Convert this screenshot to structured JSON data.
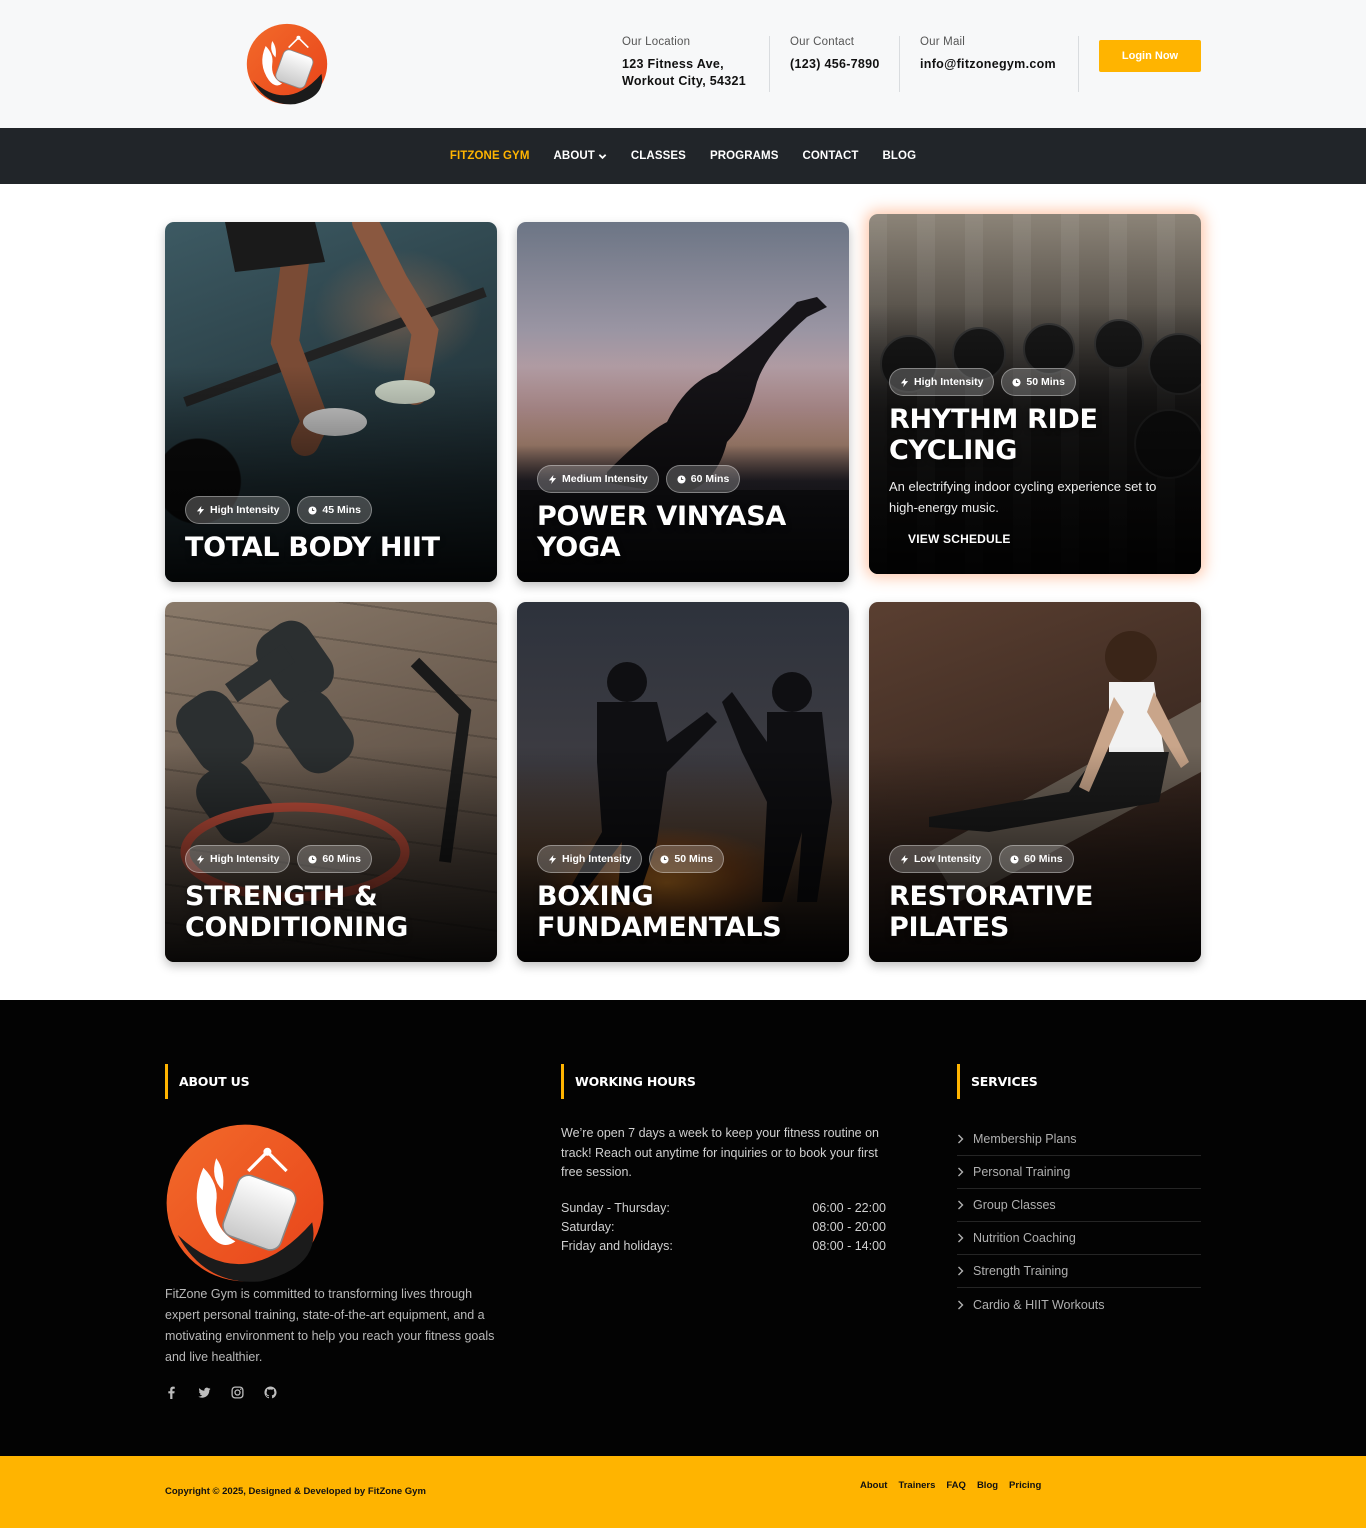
{
  "header": {
    "location_label": "Our Location",
    "location_line1": "123 Fitness Ave,",
    "location_line2": "Workout City, 54321",
    "contact_label": "Our Contact",
    "contact_value": "(123) 456-7890",
    "mail_label": "Our Mail",
    "mail_value": "info@fitzonegym.com",
    "login_label": "Login Now"
  },
  "nav": {
    "items": [
      "FITZONE GYM",
      "ABOUT",
      "CLASSES",
      "PROGRAMS",
      "CONTACT",
      "BLOG"
    ],
    "active_index": 0
  },
  "cards": [
    {
      "title": "TOTAL BODY HIIT",
      "intensity": "High Intensity",
      "duration": "45 Mins"
    },
    {
      "title": "POWER VINYASA YOGA",
      "intensity": "Medium Intensity",
      "duration": "60 Mins"
    },
    {
      "title": "RHYTHM RIDE CYCLING",
      "intensity": "High Intensity",
      "duration": "50 Mins",
      "description": "An electrifying indoor cycling experience set to high-energy music.",
      "link": "VIEW SCHEDULE"
    },
    {
      "title": "STRENGTH & CONDITIONING",
      "intensity": "High Intensity",
      "duration": "60 Mins"
    },
    {
      "title": "BOXING FUNDAMENTALS",
      "intensity": "High Intensity",
      "duration": "50 Mins"
    },
    {
      "title": "RESTORATIVE PILATES",
      "intensity": "Low Intensity",
      "duration": "60 Mins"
    }
  ],
  "footer": {
    "about_title": "ABOUT US",
    "about_text": "FitZone Gym is committed to transforming lives through expert personal training, state-of-the-art equipment, and a motivating environment to help you reach your fitness goals and live healthier.",
    "socials": [
      "facebook-icon",
      "twitter-icon",
      "instagram-icon",
      "github-icon"
    ],
    "hours_title": "WORKING HOURS",
    "hours_text": "We’re open 7 days a week to keep your fitness routine on track! Reach out anytime for inquiries or to book your first free session.",
    "hours": [
      {
        "day": "Sunday - Thursday:",
        "time": "06:00 - 22:00"
      },
      {
        "day": "Saturday:",
        "time": "08:00 - 20:00"
      },
      {
        "day": "Friday and holidays:",
        "time": "08:00 - 14:00"
      }
    ],
    "services_title": "SERVICES",
    "services": [
      "Membership Plans",
      "Personal Training",
      "Group Classes",
      "Nutrition Coaching",
      "Strength Training",
      "Cardio & HIIT Workouts"
    ]
  },
  "bottom": {
    "copyright": "Copyright © 2025, Designed & Developed by FitZone Gym",
    "links": [
      "About",
      "Trainers",
      "FAQ",
      "Blog",
      "Pricing"
    ]
  },
  "colors": {
    "accent": "#ffb400",
    "nav_bg": "#212529",
    "footer_bg": "#030303",
    "logo_orange": "#f05a22"
  }
}
